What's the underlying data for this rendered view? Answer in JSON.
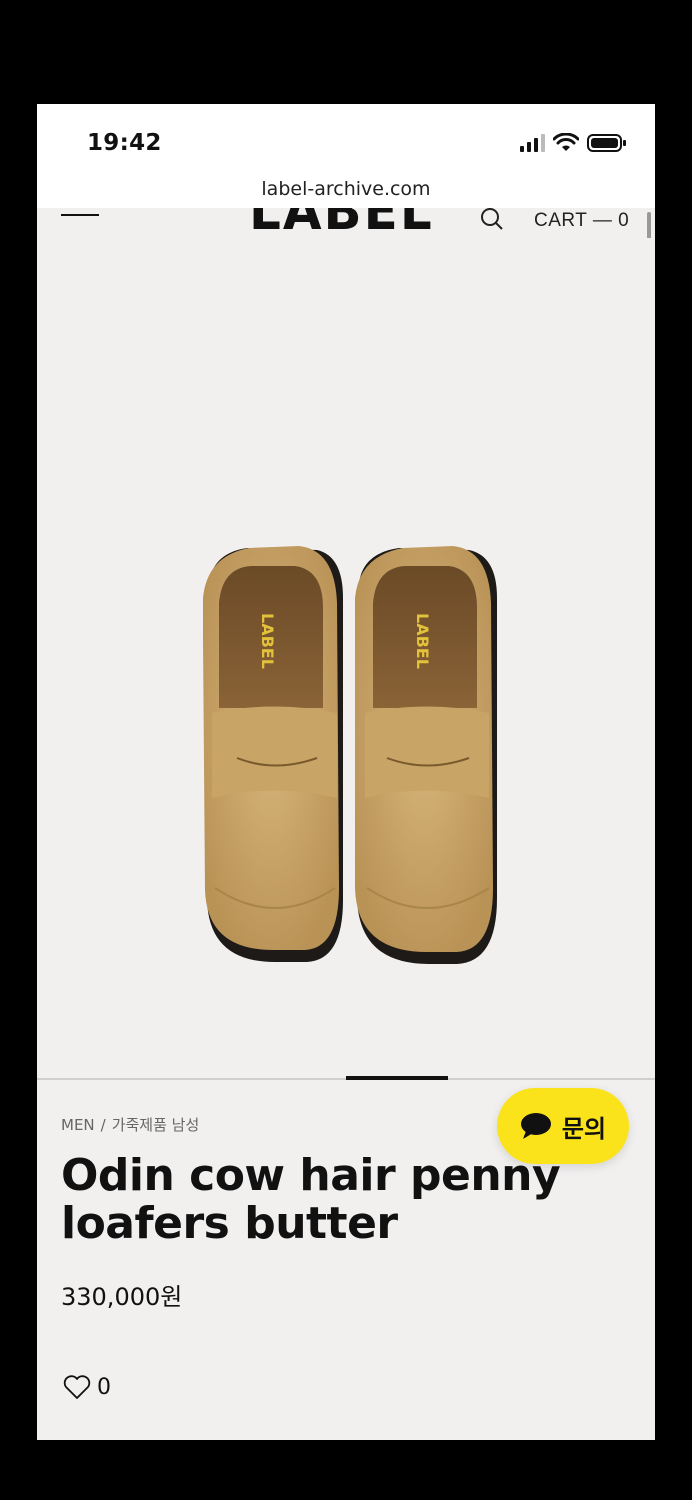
{
  "status_bar": {
    "time": "19:42"
  },
  "browser": {
    "url": "label-archive.com"
  },
  "header": {
    "logo": "LABEL",
    "cart_label": "CART — 0"
  },
  "product": {
    "breadcrumb": [
      "MEN",
      "가죽제품 남성"
    ],
    "title": "Odin cow hair penny loafers butter",
    "price": "330,000원",
    "likes": "0",
    "insole_brand": "LABEL"
  },
  "chat": {
    "label": "문의"
  },
  "colors": {
    "chat_button": "#fbe31b",
    "page_bg": "#f1f0ef",
    "suede": "#c9a66a"
  },
  "icons": [
    "signal-icon",
    "wifi-icon",
    "battery-icon",
    "menu-icon",
    "search-icon",
    "heart-icon",
    "chat-bubble-icon"
  ]
}
